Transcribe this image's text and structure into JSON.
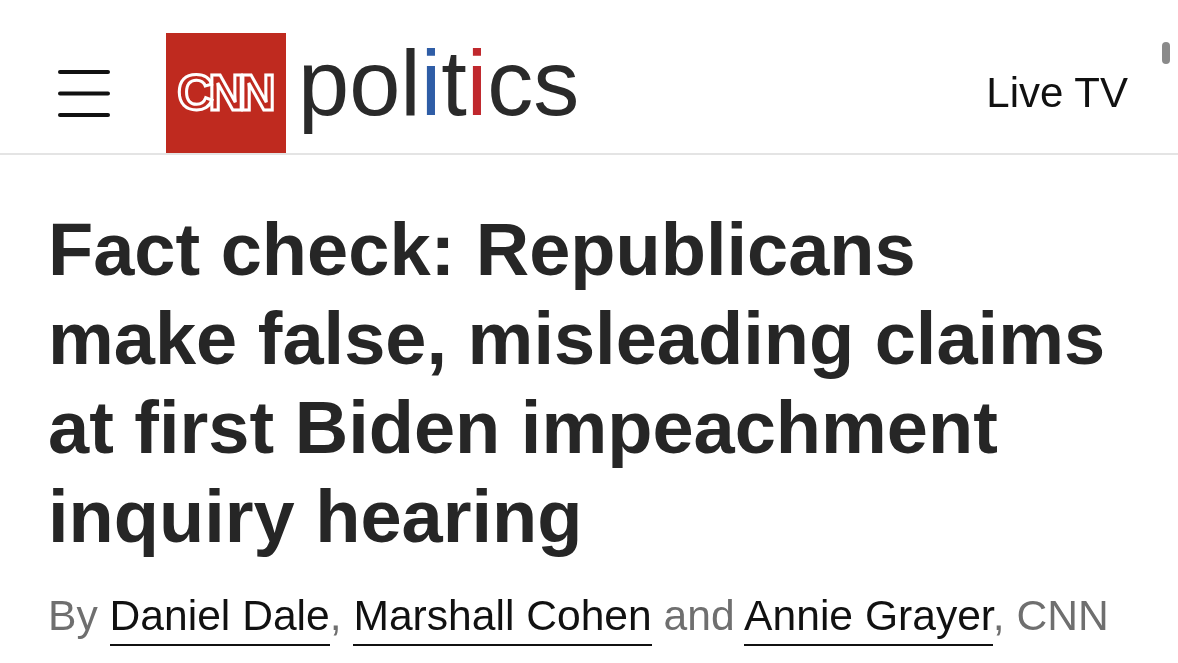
{
  "header": {
    "logo": {
      "mark": "CNN",
      "section": [
        {
          "text": "pol"
        },
        {
          "text": "i",
          "color": "#2f5da6"
        },
        {
          "text": "t"
        },
        {
          "text": "i",
          "color": "#c0282d"
        },
        {
          "text": "cs"
        }
      ]
    },
    "live_link": "Live TV"
  },
  "article": {
    "headline": "Fact check: Republicans make false, misleading claims at first Biden impeachment inquiry hearing",
    "byline": [
      {
        "kind": "text",
        "text": "By "
      },
      {
        "kind": "author",
        "text": "Daniel Dale"
      },
      {
        "kind": "text",
        "text": ", "
      },
      {
        "kind": "author",
        "text": "Marshall Cohen"
      },
      {
        "kind": "text",
        "text": " and "
      },
      {
        "kind": "author",
        "text": "Annie Grayer"
      },
      {
        "kind": "text",
        "text": ", CNN"
      }
    ]
  }
}
